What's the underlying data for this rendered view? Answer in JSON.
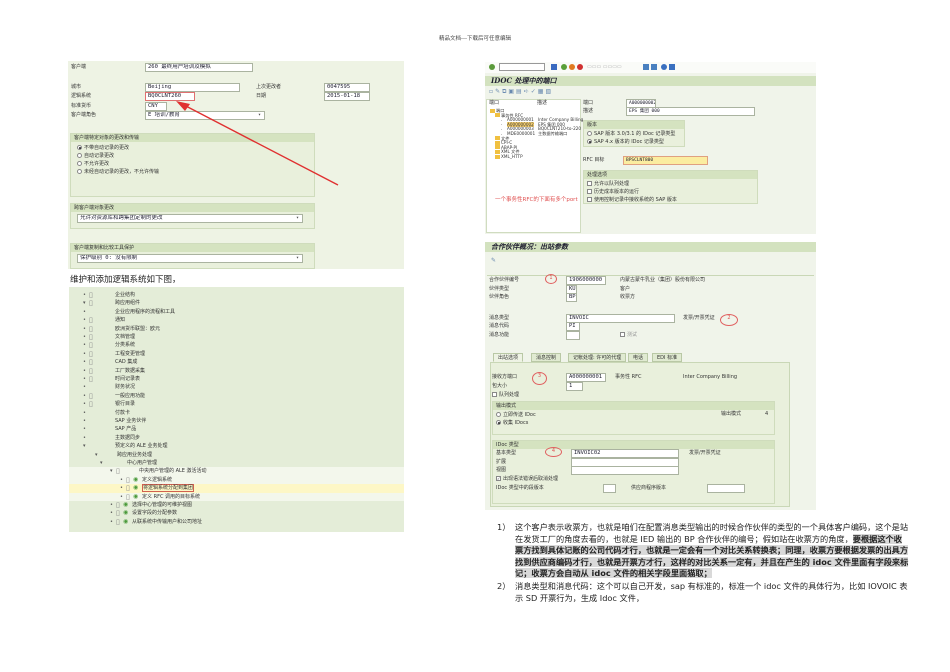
{
  "header": {
    "text": "精品文档---下载后可任意编辑"
  },
  "client_settings": {
    "client_label": "客户端",
    "client_value": "260 最终用户培训及模拟",
    "city_label": "城市",
    "city_value": "Beijing",
    "changed_by_label": "上次更改者",
    "changed_by_value": "0047595",
    "logical_system_label": "逻辑系统",
    "logical_system_value": "BQ0CLNT260",
    "date_label": "日期",
    "date_value": "2015-01-18",
    "currency_label": "标准货币",
    "currency_value": "CNY",
    "role_label": "客户端角色",
    "role_value": "E 培训/教育",
    "changes_group": {
      "title": "客户端特定对象的更改和传输",
      "options": [
        "不带自动记录的更改",
        "自动记录更改",
        "不允许更改",
        "未经自动记录的更改，不允许传输"
      ],
      "selected": 0
    },
    "cross_client_group": {
      "title": "跨客户端对象更改",
      "value": "允许对资源库和跨集团定制的更改"
    },
    "protection_group": {
      "title": "客户端复制和比较工具保护",
      "value": "保护级别 0: 没有限制"
    }
  },
  "caption1": "维护和添加逻辑系统如下图，",
  "img_tree": {
    "rows": [
      {
        "label": "企业结构",
        "level": 0,
        "state": "collapsed",
        "doc": true
      },
      {
        "label": "跨应用组件",
        "level": 0,
        "state": "expanded",
        "doc": true
      },
      {
        "label": "企业应用程序的流程和工具",
        "level": 1,
        "state": "collapsed",
        "doc": false
      },
      {
        "label": "通知",
        "level": 1,
        "state": "collapsed",
        "doc": true
      },
      {
        "label": "欧洲货币联盟：欧元",
        "level": 1,
        "state": "collapsed",
        "doc": true
      },
      {
        "label": "文档管理",
        "level": 1,
        "state": "collapsed",
        "doc": true
      },
      {
        "label": "分类系统",
        "level": 1,
        "state": "collapsed",
        "doc": true
      },
      {
        "label": "工程变更管理",
        "level": 1,
        "state": "collapsed",
        "doc": true
      },
      {
        "label": "CAD 集成",
        "level": 1,
        "state": "collapsed",
        "doc": true
      },
      {
        "label": "工厂数据采集",
        "level": 1,
        "state": "collapsed",
        "doc": true
      },
      {
        "label": "时间记录表",
        "level": 1,
        "state": "collapsed",
        "doc": true
      },
      {
        "label": "财务状况",
        "level": 1,
        "state": "collapsed",
        "doc": false
      },
      {
        "label": "一般应用功能",
        "level": 1,
        "state": "collapsed",
        "doc": true
      },
      {
        "label": "银行目录",
        "level": 1,
        "state": "collapsed",
        "doc": true
      },
      {
        "label": "付款卡",
        "level": 1,
        "state": "collapsed",
        "doc": false
      },
      {
        "label": "SAP 业务伙伴",
        "level": 1,
        "state": "collapsed",
        "doc": false
      },
      {
        "label": "SAP 产品",
        "level": 1,
        "state": "collapsed",
        "doc": false
      },
      {
        "label": "主数据同步",
        "level": 1,
        "state": "collapsed",
        "doc": false
      },
      {
        "label": "预定义的 ALE 业务处理",
        "level": 1,
        "state": "expanded",
        "doc": false
      },
      {
        "label": "跨应用业务处理",
        "level": 2,
        "state": "expanded",
        "doc": false
      },
      {
        "label": "中心用户管理",
        "level": 3,
        "state": "expanded",
        "doc": false
      },
      {
        "label": "中央用户管理的 ALE 激活活动",
        "level": 4,
        "state": "expanded",
        "doc": true
      },
      {
        "label": "定义逻辑系统",
        "level": 5,
        "state": "leaf",
        "doc": true,
        "exec": true
      },
      {
        "label": "将逻辑系统分配到集团",
        "level": 5,
        "state": "leaf",
        "doc": true,
        "exec": true,
        "selected": true
      },
      {
        "label": "定义 RFC 调用的目标系统",
        "level": 5,
        "state": "leaf",
        "doc": true,
        "exec": true
      },
      {
        "label": "选择中心管理的可维护视图",
        "level": 4,
        "state": "leaf",
        "doc": true,
        "exec": true
      },
      {
        "label": "设置字段的分配参数",
        "level": 4,
        "state": "leaf",
        "doc": true,
        "exec": true
      },
      {
        "label": "从联系统中传输用户和公司地址",
        "level": 4,
        "state": "leaf",
        "doc": true,
        "exec": true
      }
    ]
  },
  "ports": {
    "title": "IDOC 处理中的端口",
    "col_port": "端口",
    "col_desc": "描述",
    "tree": [
      {
        "label": "端口",
        "level": 0,
        "folder": true,
        "desc": ""
      },
      {
        "label": "事务性 RFC",
        "level": 1,
        "folder": true,
        "desc": ""
      },
      {
        "label": "A000000001",
        "level": 2,
        "folder": false,
        "desc": "Inter Company Billing"
      },
      {
        "label": "A000000002",
        "level": 2,
        "folder": false,
        "desc": "EPS 集团 000",
        "selected": true
      },
      {
        "label": "A000000003",
        "level": 2,
        "folder": false,
        "desc": "BQ0CLNT210-to-220"
      },
      {
        "label": "MDE0000001",
        "level": 2,
        "folder": false,
        "desc": "主数据传输端口"
      },
      {
        "label": "文件",
        "level": 1,
        "folder": true,
        "desc": ""
      },
      {
        "label": "CPI-C",
        "level": 1,
        "folder": true,
        "desc": ""
      },
      {
        "label": "ABAP-PI",
        "level": 1,
        "folder": true,
        "desc": ""
      },
      {
        "label": "XML 文件",
        "level": 1,
        "folder": true,
        "desc": ""
      },
      {
        "label": "XML_HTTP",
        "level": 1,
        "folder": true,
        "desc": ""
      }
    ],
    "note": "一个事务性RFC的下面有多个port",
    "port_label": "端口",
    "port_value": "A000000002",
    "desc_label": "描述",
    "desc_value": "EPS 集团 000",
    "version_title": "版本",
    "version_options": [
      "SAP 版本 3.0/3.1 的 IDoc 记录类型",
      "SAP 4.x 版本的 IDoc 记录类型"
    ],
    "rfc_label": "RFC 目标",
    "rfc_value": "BPSCLNT800",
    "processing_title": "处理选项",
    "processing_options": [
      "允许以队列处理",
      "历史成本版本的运行",
      "使用控制记录中接收系统的 SAP 版本"
    ]
  },
  "partner": {
    "title": "合作伙伴概况：出站参数",
    "partner_no_label": "合作伙伴编号",
    "partner_no_value": "1906000000",
    "partner_name": "内蒙古蒙牛乳业（集团）股份有限公司",
    "partner_type_label": "伙伴类型",
    "partner_type_value": "KU",
    "partner_type_text": "客户",
    "partner_role_label": "伙伴角色",
    "partner_role_value": "BP",
    "partner_role_text": "收票方",
    "msg_type_label": "消息类型",
    "msg_type_value": "INVOIC",
    "msg_type_text": "发票/开票凭证",
    "msg_code_label": "消息代码",
    "msg_code_value": "PI",
    "msg_func_label": "消息功能",
    "test_label": "测试",
    "tabs": [
      "出站选项",
      "消息控制",
      "记帐处理: 许可的代理",
      "电话",
      "EDI 标准"
    ],
    "receiver_port_label": "接收方端口",
    "receiver_port_value": "A000000001",
    "port_type": "事务性 RFC",
    "port_desc": "Inter Company Billing",
    "pack_size_label": "包大小",
    "pack_size_value": "1",
    "queue_label": "队列处理",
    "output_mode_title": "输出模式",
    "output_options": [
      "立即传送 IDoc",
      "收集 IDocs"
    ],
    "output_mode_label": "输出模式",
    "output_mode_value": "4",
    "idoc_type_title": "IDoc 类型",
    "basic_type_label": "基本类型",
    "basic_type_value": "INVOIC02",
    "basic_type_text": "发票/开票凭证",
    "extension_label": "扩展",
    "view_label": "视图",
    "cancel_label": "出现语法错误后取消处理",
    "seg_release_label": "IDoc 类型中的段版本",
    "app_release_label": "供应商程序版本",
    "circles": [
      "1",
      "2",
      "3",
      "4"
    ]
  },
  "notes": [
    {
      "num": "1）",
      "plain": "这个客户表示收票方，也就是咱们在配置消息类型输出的时候合作伙伴的类型的一个具体客户编码，这个是站在发货工厂的角度去看的，也就是 IED 输出的 BP 合作伙伴的编号；假如站在收票方的角度，",
      "bold": "要根据这个收票方找到具体记账的公司代码才行，也就是一定会有一个对比关系转换表；同理，收票方要根据发票的出具方找到供应商编码才行，也就是开票方才行，这样的对比关系一定有，并且在产生的 idoc 文件里面有字段来标记；收票方会自动从 idoc 文件的相关字段里面猫取；"
    },
    {
      "num": "2）",
      "plain": "消息类型和消息代码：这个可以自己开发，sap 有标准的，标准一个 idoc 文件的具体行为，比如 IOVOIC 表示 SD 开票行为，生成 Idoc 文件，",
      "bold": ""
    }
  ]
}
